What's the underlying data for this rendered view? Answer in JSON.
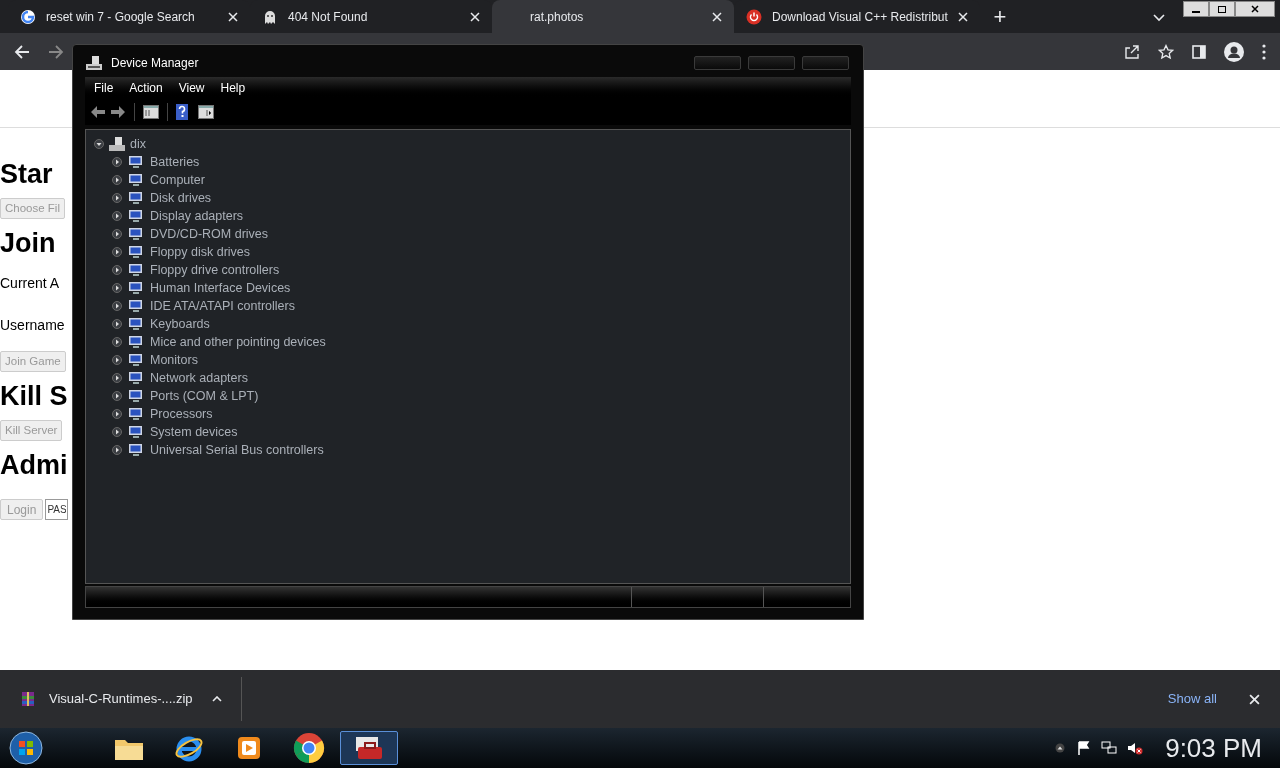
{
  "browser": {
    "tabs": [
      {
        "title": "reset win 7 - Google Search",
        "selected": false
      },
      {
        "title": "404 Not Found",
        "selected": false
      },
      {
        "title": "rat.photos",
        "selected": true
      },
      {
        "title": "Download Visual C++ Redistribut",
        "selected": false
      }
    ],
    "new_tab": "+"
  },
  "page": {
    "blocks": [
      {
        "kind": "heading",
        "text": "Star"
      },
      {
        "kind": "button",
        "text": "Choose Fil"
      },
      {
        "kind": "heading",
        "text": "Join"
      },
      {
        "kind": "text",
        "text": "Current A"
      },
      {
        "kind": "text",
        "text": "Username"
      },
      {
        "kind": "button",
        "text": "Join Game"
      },
      {
        "kind": "heading",
        "text": "Kill S"
      },
      {
        "kind": "button",
        "text": "Kill Server"
      },
      {
        "kind": "heading",
        "text": "Admi"
      },
      {
        "kind": "login",
        "text": "Login",
        "placeholder": "PAS"
      }
    ]
  },
  "window": {
    "title": "Device Manager",
    "menu": [
      "File",
      "Action",
      "View",
      "Help"
    ],
    "tree": {
      "label": "dix",
      "expanded": true,
      "children": [
        {
          "label": "Batteries",
          "expanded": false
        },
        {
          "label": "Computer",
          "expanded": false
        },
        {
          "label": "Disk drives",
          "expanded": false
        },
        {
          "label": "Display adapters",
          "expanded": false
        },
        {
          "label": "DVD/CD-ROM drives",
          "expanded": false
        },
        {
          "label": "Floppy disk drives",
          "expanded": false
        },
        {
          "label": "Floppy drive controllers",
          "expanded": false
        },
        {
          "label": "Human Interface Devices",
          "expanded": false
        },
        {
          "label": "IDE ATA/ATAPI controllers",
          "expanded": false
        },
        {
          "label": "Keyboards",
          "expanded": false
        },
        {
          "label": "Mice and other pointing devices",
          "expanded": false
        },
        {
          "label": "Monitors",
          "expanded": false
        },
        {
          "label": "Network adapters",
          "expanded": false
        },
        {
          "label": "Ports (COM & LPT)",
          "expanded": false
        },
        {
          "label": "Processors",
          "expanded": false
        },
        {
          "label": "System devices",
          "expanded": false
        },
        {
          "label": "Universal Serial Bus controllers",
          "expanded": false
        }
      ]
    }
  },
  "downloads": {
    "file": "Visual-C-Runtimes-....zip",
    "show_all": "Show all"
  },
  "taskbar": {
    "apps": [
      {
        "selected": false
      },
      {
        "selected": false
      },
      {
        "selected": false
      },
      {
        "selected": false
      },
      {
        "selected": true
      }
    ],
    "clock": "9:03 PM"
  }
}
